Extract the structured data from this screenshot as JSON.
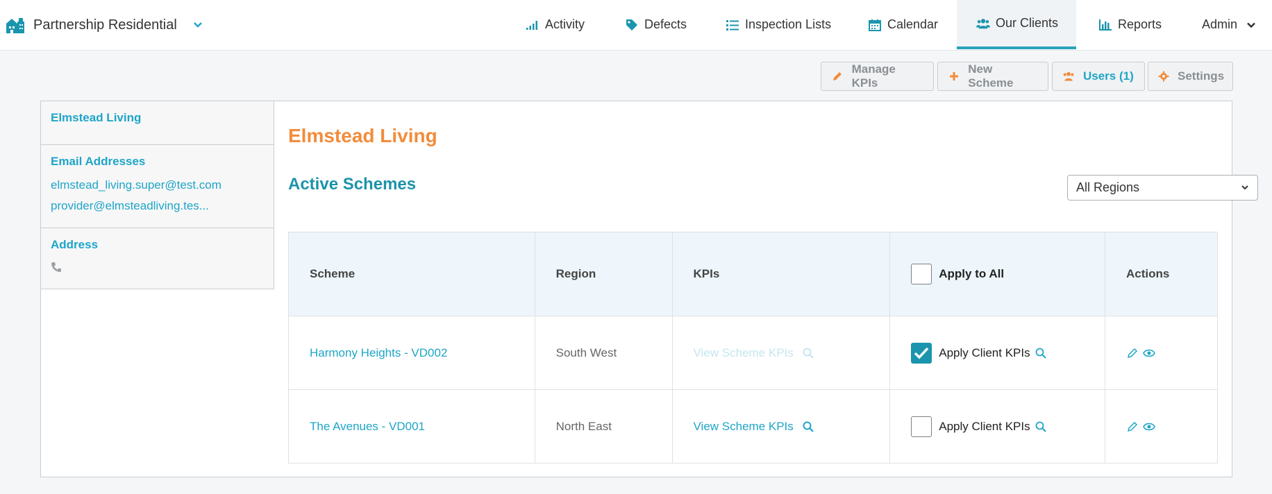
{
  "brand": {
    "name": "Partnership Residential"
  },
  "nav": {
    "items": [
      {
        "label": "Activity"
      },
      {
        "label": "Defects"
      },
      {
        "label": "Inspection Lists"
      },
      {
        "label": "Calendar"
      },
      {
        "label": "Our Clients"
      },
      {
        "label": "Reports"
      },
      {
        "label": "Admin"
      }
    ]
  },
  "toolbar": {
    "manage_kpis": "Manage KPIs",
    "new_scheme": "New Scheme",
    "users": "Users (1)",
    "settings": "Settings"
  },
  "sidebar": {
    "client_name": "Elmstead Living",
    "email_title": "Email Addresses",
    "emails": [
      "elmstead_living.super@test.com",
      "provider@elmsteadliving.tes..."
    ],
    "address_title": "Address"
  },
  "main": {
    "client_title": "Elmstead Living",
    "section_title": "Active Schemes",
    "region_filter": "All Regions",
    "table": {
      "headers": [
        "Scheme",
        "Region",
        "KPIs",
        "Apply to All",
        "Actions"
      ],
      "rows": [
        {
          "scheme": "Harmony Heights - VD002",
          "region": "South West",
          "kpis": "View Scheme KPIs",
          "apply": "Apply Client KPIs",
          "checked": true
        },
        {
          "scheme": "The Avenues - VD001",
          "region": "North East",
          "kpis": "View Scheme KPIs",
          "apply": "Apply Client KPIs",
          "checked": false
        }
      ]
    }
  },
  "colors": {
    "accent": "#1ea5c8",
    "title_orange": "#f28c3b",
    "section_teal": "#1d93aa"
  }
}
